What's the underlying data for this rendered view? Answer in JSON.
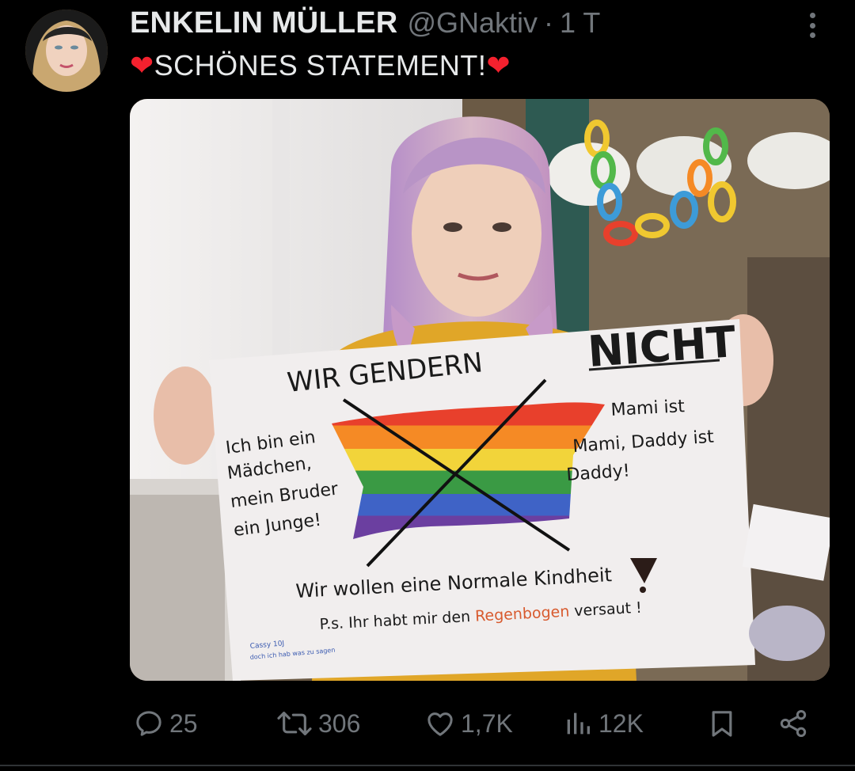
{
  "tweet": {
    "author_name": "ENKELIN MÜLLER",
    "handle": "@GNaktiv",
    "separator": "·",
    "time": "1 T",
    "text_heart": "❤",
    "text": "SCHÖNES  STATEMENT!",
    "text_heart_end": "❤"
  },
  "poster": {
    "headline_left": "WIR GENDERN",
    "headline_right": "NICHT",
    "left_text_lines": [
      "Ich bin ein",
      "Mädchen,",
      "mein Bruder",
      "ein Junge!"
    ],
    "right_text_lines": [
      "Mami ist",
      "Mami, Daddy ist",
      "Daddy!"
    ],
    "bottom_line_1": "Wir wollen eine Normale Kindheit",
    "bottom_line_2_prefix": "P.s. Ihr habt mir den ",
    "bottom_line_2_rainbow": "Regenbogen",
    "bottom_line_2_suffix": " versaut !",
    "signature_1": "Cassy 10J",
    "signature_2": "doch ich hab was zu sagen"
  },
  "actions": {
    "reply_count": "25",
    "retweet_count": "306",
    "like_count": "1,7K",
    "views_count": "12K"
  },
  "icons": [
    "more-icon",
    "reply-icon",
    "retweet-icon",
    "like-icon",
    "views-icon",
    "bookmark-icon",
    "share-icon"
  ],
  "colors": {
    "background": "#000000",
    "text": "#e7e9ea",
    "muted": "#71767b",
    "heart": "#f4212e"
  }
}
